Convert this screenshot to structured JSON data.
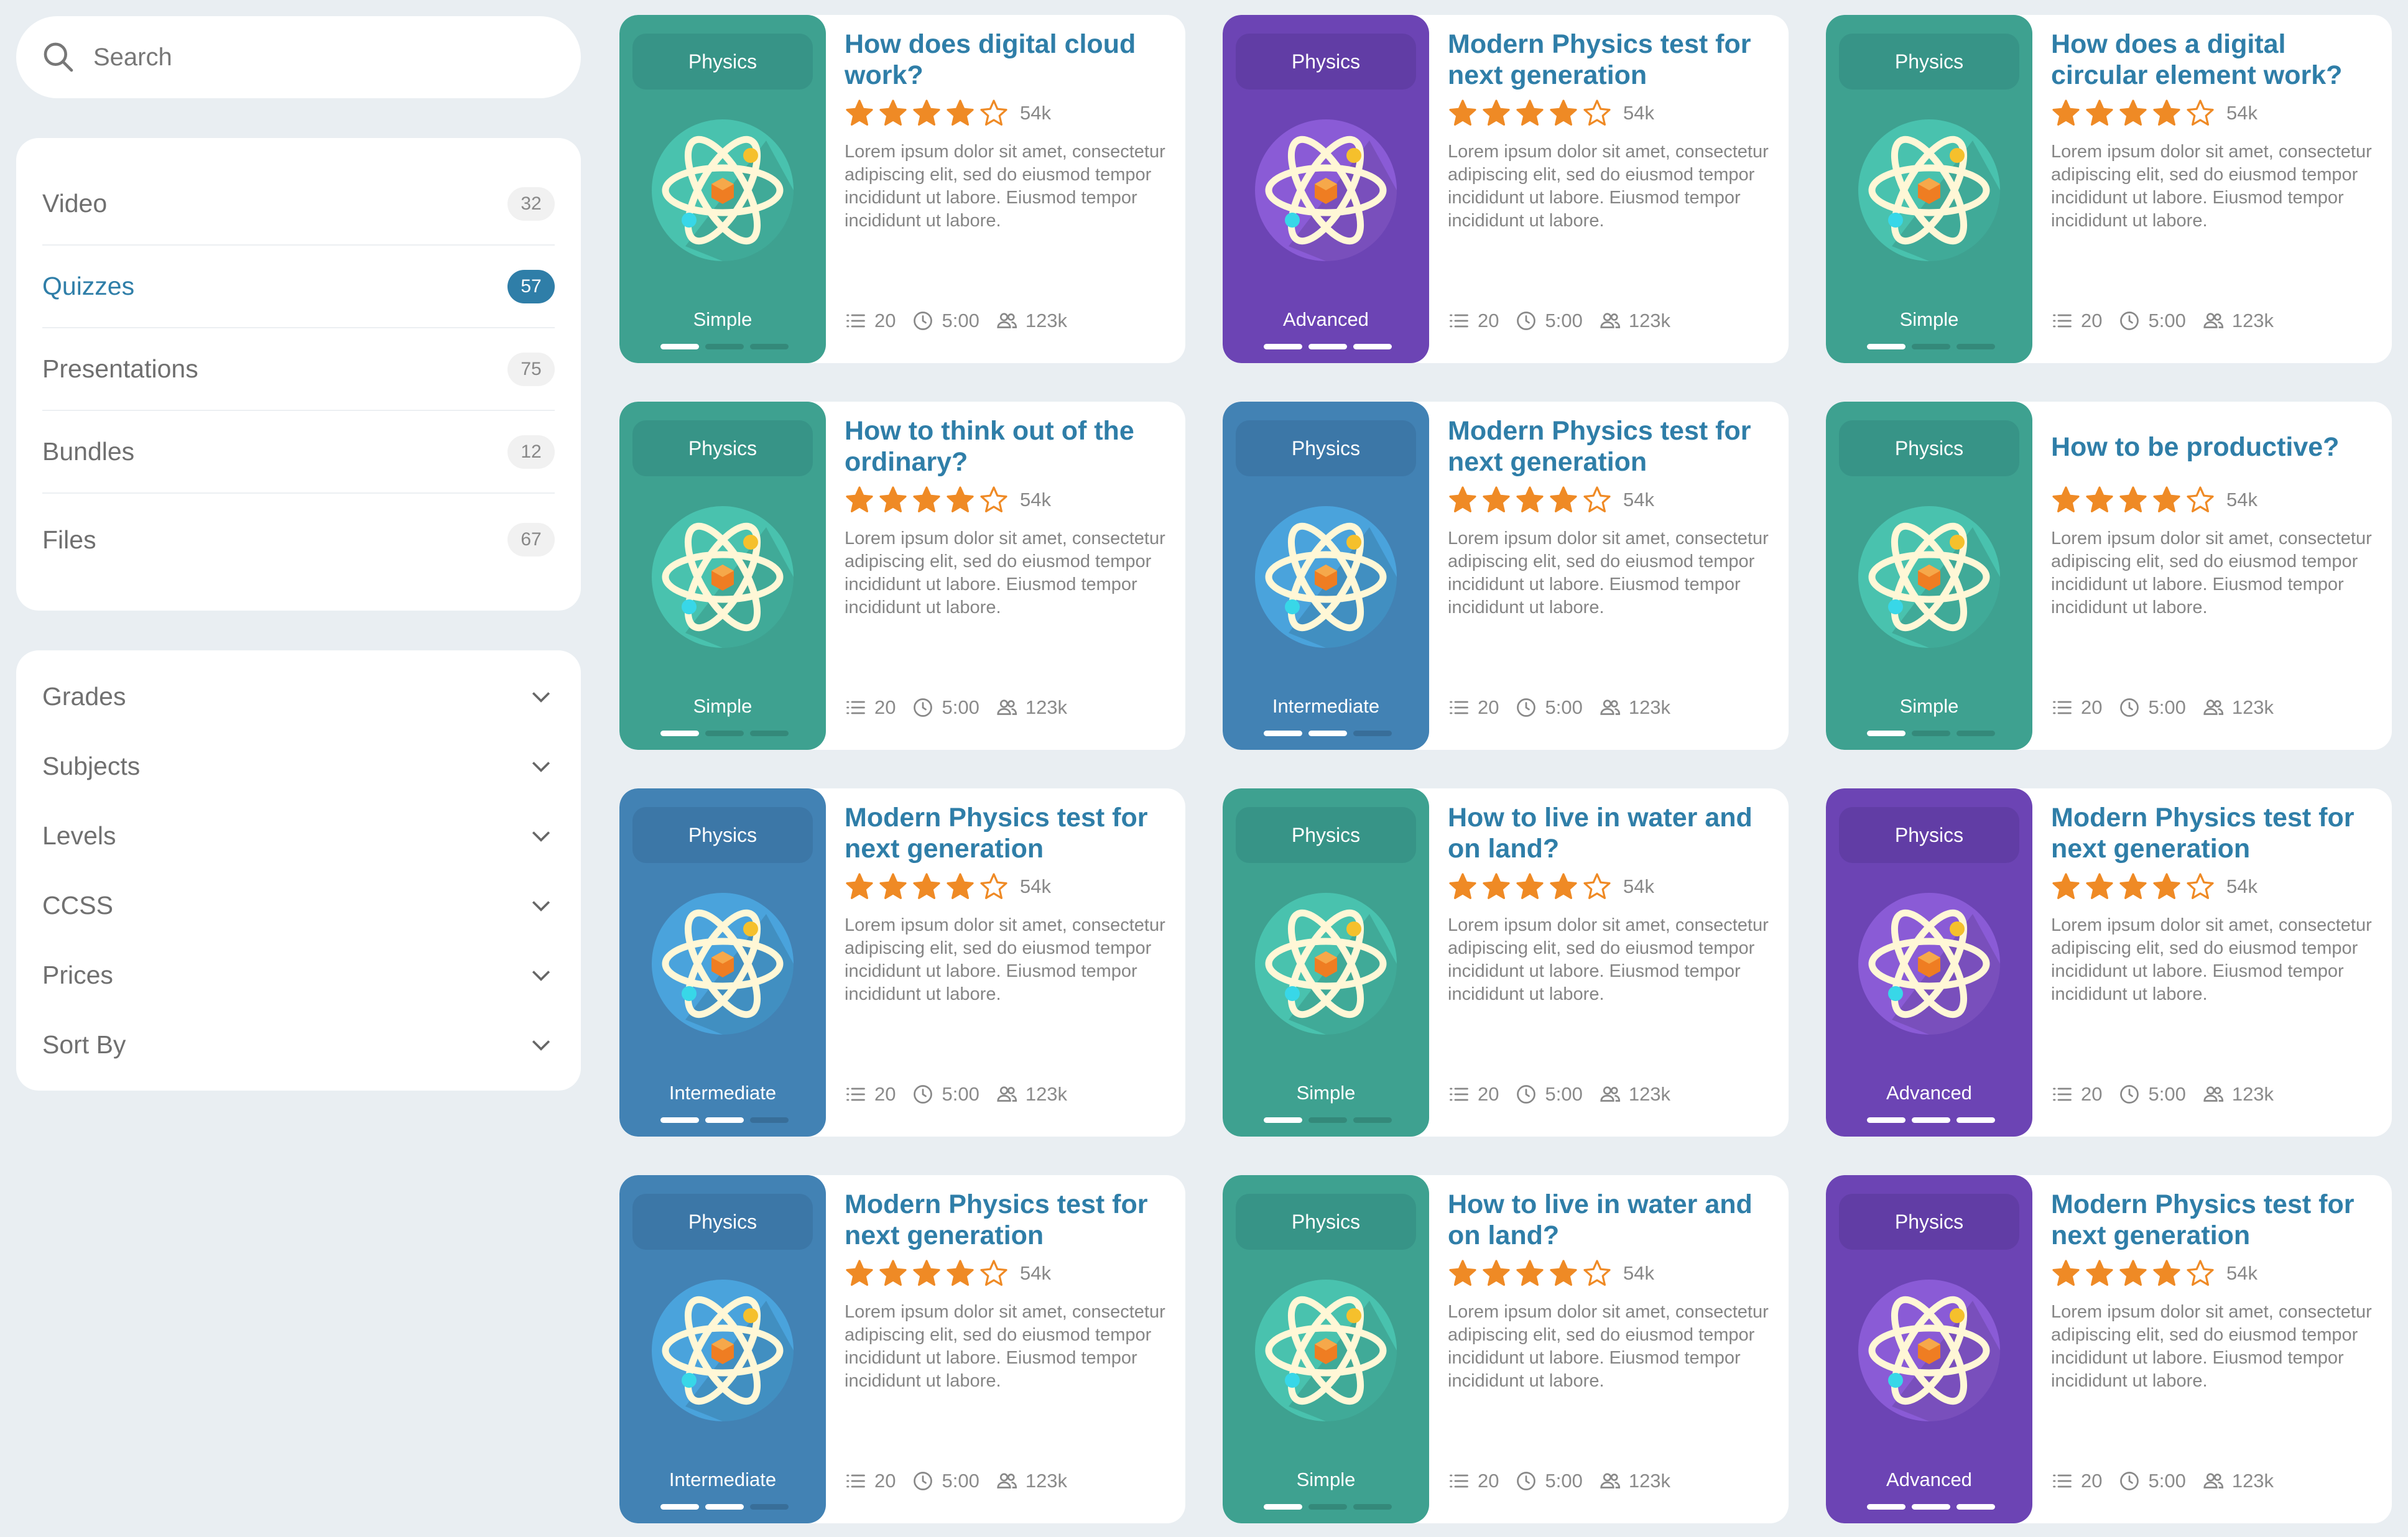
{
  "search": {
    "placeholder": "Search"
  },
  "categories": [
    {
      "label": "Video",
      "count": "32"
    },
    {
      "label": "Quizzes",
      "count": "57"
    },
    {
      "label": "Presentations",
      "count": "75"
    },
    {
      "label": "Bundles",
      "count": "12"
    },
    {
      "label": "Files",
      "count": "67"
    }
  ],
  "filters": [
    {
      "label": "Grades"
    },
    {
      "label": "Subjects"
    },
    {
      "label": "Levels"
    },
    {
      "label": "CCSS"
    },
    {
      "label": "Prices"
    },
    {
      "label": "Sort By"
    }
  ],
  "colors": {
    "accent": "#2f7ea8",
    "star": "#ef8a25",
    "Simple": {
      "bg": "#3ea190",
      "tag": "#379487",
      "ring": "#49c2ae"
    },
    "Intermediate": {
      "bg": "#4282b4",
      "tag": "#3c77a7",
      "ring": "#4aa3dc"
    },
    "Advanced": {
      "bg": "#6c44b4",
      "tag": "#613da5",
      "ring": "#8a5bd6"
    }
  },
  "cards": [
    {
      "subject": "Physics",
      "title": "How does digital cloud work?",
      "rating_count": "54k",
      "stars": 4,
      "description": "Lorem ipsum dolor sit amet, consectetur adipiscing elit, sed do eiusmod tempor incididunt ut labore. Eiusmod tempor incididunt ut labore.",
      "level": "Simple",
      "level_steps": 1,
      "questions": "20",
      "duration": "5:00",
      "participants": "123k"
    },
    {
      "subject": "Physics",
      "title": "Modern Physics test for next generation",
      "rating_count": "54k",
      "stars": 4,
      "description": "Lorem ipsum dolor sit amet, consectetur adipiscing elit, sed do eiusmod tempor incididunt ut labore. Eiusmod tempor incididunt ut labore.",
      "level": "Advanced",
      "level_steps": 3,
      "questions": "20",
      "duration": "5:00",
      "participants": "123k"
    },
    {
      "subject": "Physics",
      "title": "How does a digital circular element work?",
      "rating_count": "54k",
      "stars": 4,
      "description": "Lorem ipsum dolor sit amet, consectetur adipiscing elit, sed do eiusmod tempor incididunt ut labore. Eiusmod tempor incididunt ut labore.",
      "level": "Simple",
      "level_steps": 1,
      "questions": "20",
      "duration": "5:00",
      "participants": "123k"
    },
    {
      "subject": "Physics",
      "title": "How to think out of the ordinary?",
      "rating_count": "54k",
      "stars": 4,
      "description": "Lorem ipsum dolor sit amet, consectetur adipiscing elit, sed do eiusmod tempor incididunt ut labore. Eiusmod tempor incididunt ut labore.",
      "level": "Simple",
      "level_steps": 1,
      "questions": "20",
      "duration": "5:00",
      "participants": "123k"
    },
    {
      "subject": "Physics",
      "title": "Modern Physics test for next generation",
      "rating_count": "54k",
      "stars": 4,
      "description": "Lorem ipsum dolor sit amet, consectetur adipiscing elit, sed do eiusmod tempor incididunt ut labore. Eiusmod tempor incididunt ut labore.",
      "level": "Intermediate",
      "level_steps": 2,
      "questions": "20",
      "duration": "5:00",
      "participants": "123k"
    },
    {
      "subject": "Physics",
      "title": "How to be productive?",
      "rating_count": "54k",
      "stars": 4,
      "description": "Lorem ipsum dolor sit amet, consectetur adipiscing elit, sed do eiusmod tempor incididunt ut labore. Eiusmod tempor incididunt ut labore.",
      "level": "Simple",
      "level_steps": 1,
      "questions": "20",
      "duration": "5:00",
      "participants": "123k"
    },
    {
      "subject": "Physics",
      "title": "Modern Physics test for next generation",
      "rating_count": "54k",
      "stars": 4,
      "description": "Lorem ipsum dolor sit amet, consectetur adipiscing elit, sed do eiusmod tempor incididunt ut labore. Eiusmod tempor incididunt ut labore.",
      "level": "Intermediate",
      "level_steps": 2,
      "questions": "20",
      "duration": "5:00",
      "participants": "123k"
    },
    {
      "subject": "Physics",
      "title": "How to live in water and on land?",
      "rating_count": "54k",
      "stars": 4,
      "description": "Lorem ipsum dolor sit amet, consectetur adipiscing elit, sed do eiusmod tempor incididunt ut labore. Eiusmod tempor incididunt ut labore.",
      "level": "Simple",
      "level_steps": 1,
      "questions": "20",
      "duration": "5:00",
      "participants": "123k"
    },
    {
      "subject": "Physics",
      "title": "Modern Physics test for next generation",
      "rating_count": "54k",
      "stars": 4,
      "description": "Lorem ipsum dolor sit amet, consectetur adipiscing elit, sed do eiusmod tempor incididunt ut labore. Eiusmod tempor incididunt ut labore.",
      "level": "Advanced",
      "level_steps": 3,
      "questions": "20",
      "duration": "5:00",
      "participants": "123k"
    },
    {
      "subject": "Physics",
      "title": "Modern Physics test for next generation",
      "rating_count": "54k",
      "stars": 4,
      "description": "Lorem ipsum dolor sit amet, consectetur adipiscing elit, sed do eiusmod tempor incididunt ut labore. Eiusmod tempor incididunt ut labore.",
      "level": "Intermediate",
      "level_steps": 2,
      "questions": "20",
      "duration": "5:00",
      "participants": "123k"
    },
    {
      "subject": "Physics",
      "title": "How to live in water and on land?",
      "rating_count": "54k",
      "stars": 4,
      "description": "Lorem ipsum dolor sit amet, consectetur adipiscing elit, sed do eiusmod tempor incididunt ut labore. Eiusmod tempor incididunt ut labore.",
      "level": "Simple",
      "level_steps": 1,
      "questions": "20",
      "duration": "5:00",
      "participants": "123k"
    },
    {
      "subject": "Physics",
      "title": "Modern Physics test for next generation",
      "rating_count": "54k",
      "stars": 4,
      "description": "Lorem ipsum dolor sit amet, consectetur adipiscing elit, sed do eiusmod tempor incididunt ut labore. Eiusmod tempor incididunt ut labore.",
      "level": "Advanced",
      "level_steps": 3,
      "questions": "20",
      "duration": "5:00",
      "participants": "123k"
    }
  ]
}
